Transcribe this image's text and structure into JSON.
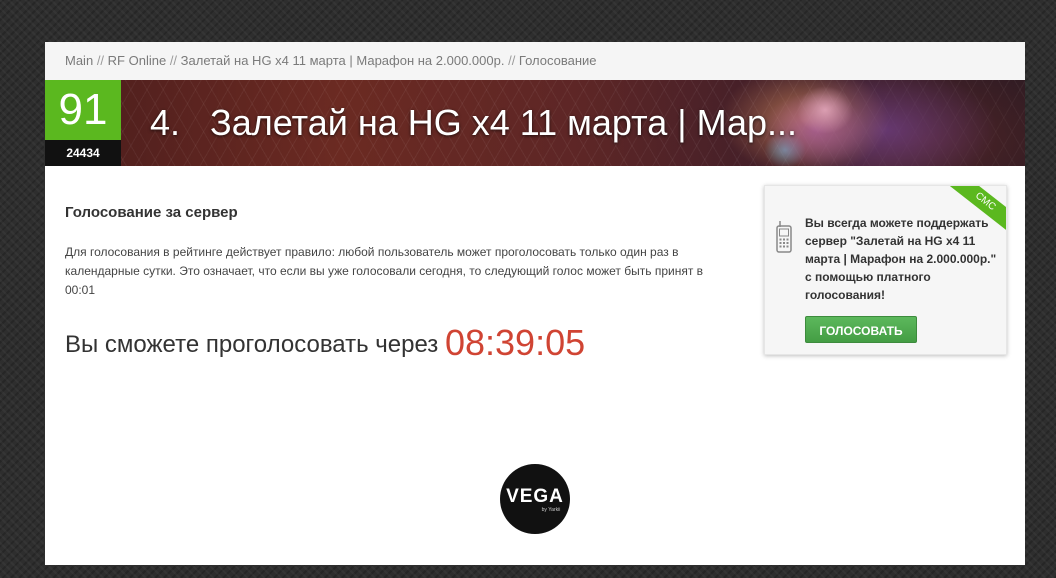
{
  "breadcrumb": {
    "items": [
      "Main",
      "RF Online",
      "Залетай на HG x4 11 марта | Марафон на 2.000.000р.",
      "Голосование"
    ],
    "separator": "//"
  },
  "server": {
    "score": "91",
    "votes": "24434",
    "rank": "4.",
    "title": "Залетай на HG x4 11 марта | Мар..."
  },
  "vote": {
    "heading": "Голосование за сервер",
    "rule": "Для голосования в рейтинге действует правило: любой пользователь может проголосовать только один раз в календарные сутки. Это означает, что если вы уже голосовали сегодня, то следующий голос может быть принят в 00:01",
    "countdown_label": "Вы сможете проголосовать через",
    "countdown_time": "08:39:05"
  },
  "sms": {
    "ribbon": "СМС",
    "text": "Вы всегда можете поддержать сервер \"Залетай на HG x4 11 марта | Марафон на 2.000.000р.\" с помощью платного голосования!",
    "button_label": "ГОЛОСОВАТЬ",
    "icon": "phone-icon"
  },
  "logo": {
    "word": "VEGA",
    "sub": "by Yarkii"
  },
  "colors": {
    "accent_green": "#5bb81f",
    "countdown_red": "#d04433",
    "button_green": "#5cb85c"
  }
}
